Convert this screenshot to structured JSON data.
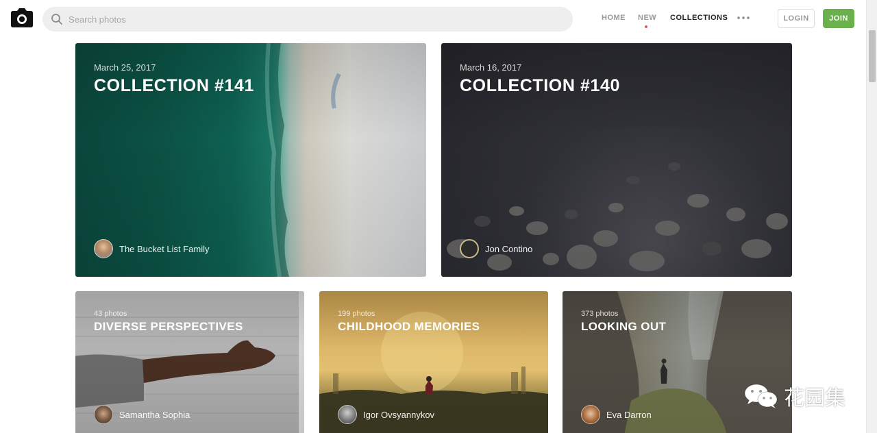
{
  "header": {
    "search_placeholder": "Search photos",
    "nav": {
      "home": "HOME",
      "new": "NEW",
      "collections": "COLLECTIONS"
    },
    "login": "LOGIN",
    "join": "JOIN",
    "icons": {
      "logo": "camera-icon",
      "search": "search-icon",
      "more": "more-dots-icon"
    }
  },
  "featured": [
    {
      "date": "March 25, 2017",
      "title": "COLLECTION #141",
      "author": "The Bucket List Family"
    },
    {
      "date": "March 16, 2017",
      "title": "COLLECTION #140",
      "author": "Jon Contino"
    }
  ],
  "collections": [
    {
      "count": "43 photos",
      "title": "DIVERSE PERSPECTIVES",
      "author": "Samantha Sophia"
    },
    {
      "count": "199 photos",
      "title": "CHILDHOOD MEMORIES",
      "author": "Igor Ovsyannykov"
    },
    {
      "count": "373 photos",
      "title": "LOOKING OUT",
      "author": "Eva Darron"
    }
  ],
  "watermark": {
    "text": "花园集",
    "icon": "wechat-icon"
  },
  "colors": {
    "join": "#6ab04c",
    "accent_dot": "#e25c5c"
  }
}
